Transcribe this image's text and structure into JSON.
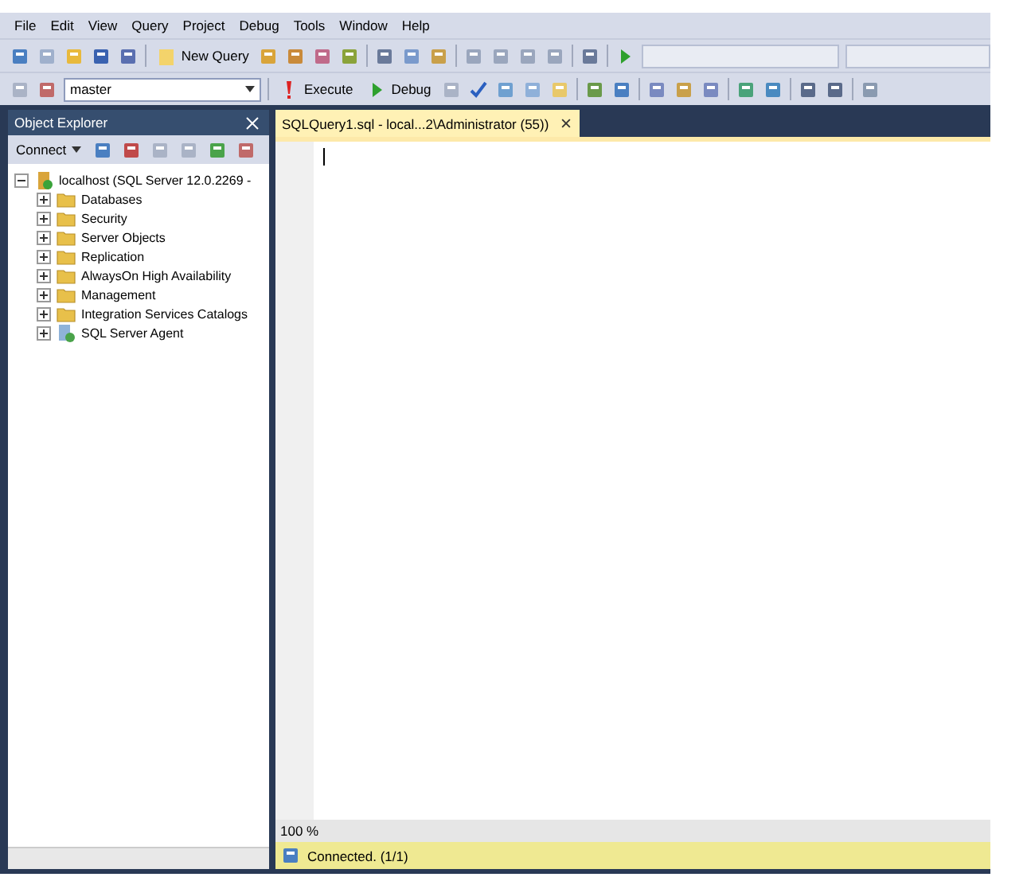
{
  "menu": [
    "File",
    "Edit",
    "View",
    "Query",
    "Project",
    "Debug",
    "Tools",
    "Window",
    "Help"
  ],
  "toolbar": {
    "new_query": "New Query",
    "database": "master",
    "execute": "Execute",
    "debug": "Debug"
  },
  "object_explorer": {
    "title": "Object Explorer",
    "connect": "Connect",
    "tree": [
      {
        "label": "localhost (SQL Server 12.0.2269 -",
        "kind": "server",
        "expanded": true,
        "children": [
          {
            "label": "Databases",
            "kind": "folder",
            "expanded": false
          },
          {
            "label": "Security",
            "kind": "folder",
            "expanded": false
          },
          {
            "label": "Server Objects",
            "kind": "folder",
            "expanded": false
          },
          {
            "label": "Replication",
            "kind": "folder",
            "expanded": false
          },
          {
            "label": "AlwaysOn High Availability",
            "kind": "folder",
            "expanded": false
          },
          {
            "label": "Management",
            "kind": "folder",
            "expanded": false
          },
          {
            "label": "Integration Services Catalogs",
            "kind": "folder",
            "expanded": false
          },
          {
            "label": "SQL Server Agent",
            "kind": "agent",
            "expanded": false
          }
        ]
      }
    ]
  },
  "editor": {
    "tab": "SQLQuery1.sql - local...2\\Administrator (55))",
    "zoom": "100 %",
    "status": "Connected. (1/1)"
  }
}
